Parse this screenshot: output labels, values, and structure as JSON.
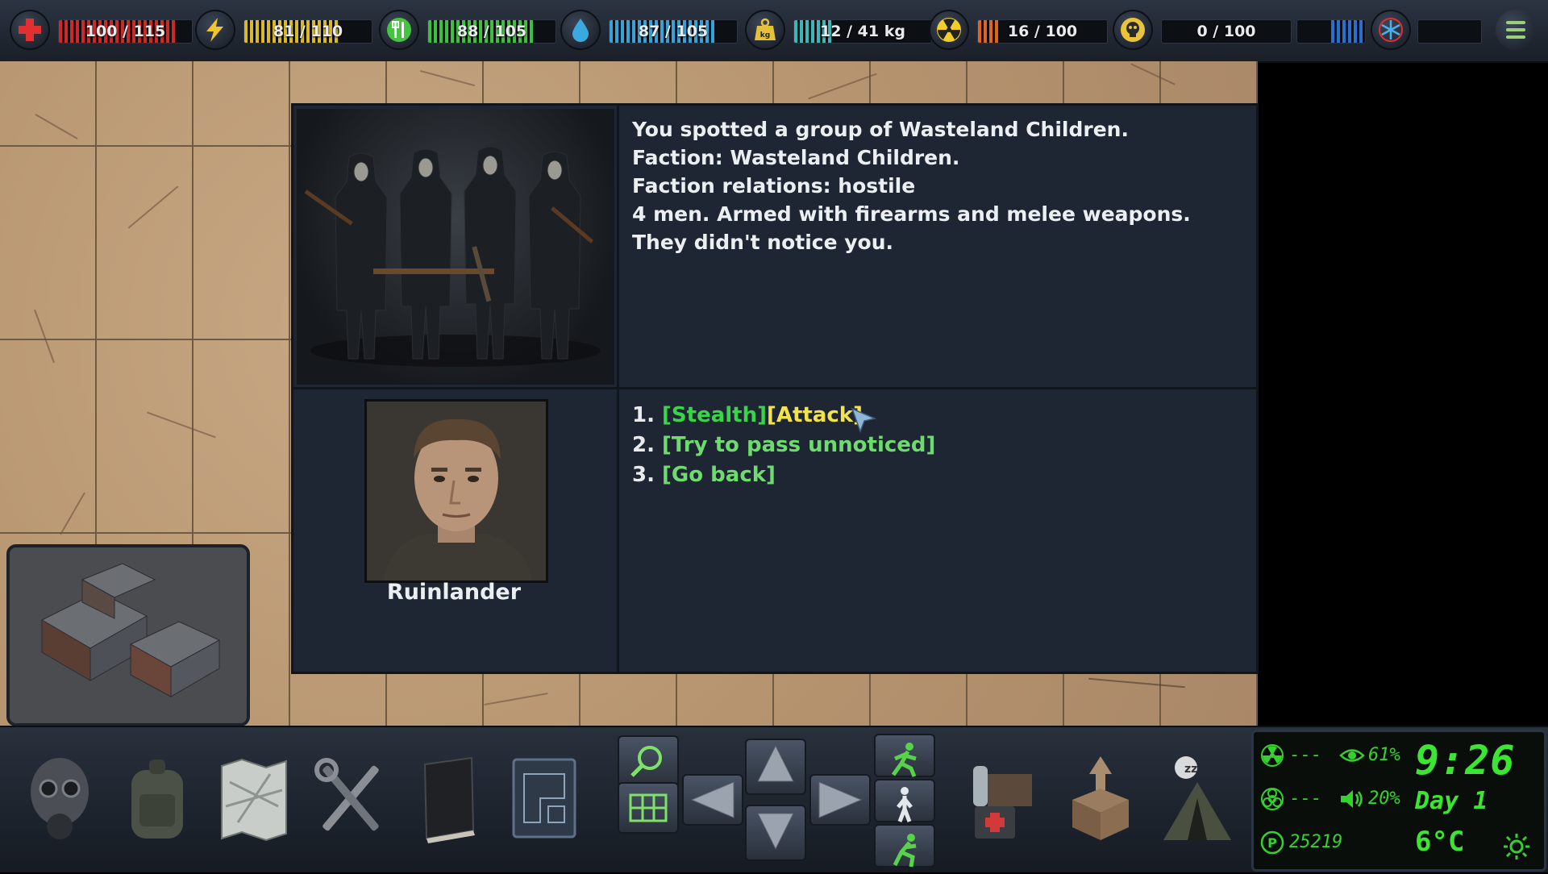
{
  "top_bar": {
    "stats": [
      {
        "name": "health",
        "text": "100 / 115",
        "fraction": 0.87,
        "color": "#d62a2a",
        "icon": "red-cross-icon"
      },
      {
        "name": "energy",
        "text": "81 / 110",
        "fraction": 0.74,
        "color": "#e4c12a",
        "icon": "lightning-icon"
      },
      {
        "name": "food",
        "text": "88 / 105",
        "fraction": 0.84,
        "color": "#3fc93f",
        "icon": "fork-knife-icon"
      },
      {
        "name": "water",
        "text": "87 / 105",
        "fraction": 0.83,
        "color": "#3aa9e0",
        "icon": "water-drop-icon"
      },
      {
        "name": "weight",
        "text": "12 / 41 kg",
        "fraction": 0.29,
        "color": "#3ec0c0",
        "icon": "weight-icon"
      },
      {
        "name": "radiation",
        "text": "16 / 100",
        "fraction": 0.16,
        "color": "#e86a1e",
        "icon": "radiation-icon"
      },
      {
        "name": "toxicity",
        "text": "0 / 100",
        "fraction": 0.0,
        "color": "#c9c9c9",
        "icon": "skull-icon"
      },
      {
        "name": "temperature",
        "text": "",
        "fraction": 0.5,
        "color": "#2e73d8",
        "icon": "snowflake-icon"
      }
    ],
    "menu_icon": "hamburger-menu-icon"
  },
  "encounter": {
    "description": [
      "You spotted a group of Wasteland Children.",
      "Faction: Wasteland Children.",
      "Faction relations: hostile",
      "4 men. Armed with firearms and melee weapons.",
      "They didn't notice you."
    ],
    "character_name": "Ruinlander",
    "options": [
      {
        "number": "1.",
        "stealth_tag": "[Stealth]",
        "attack_tag": "[Attack]"
      },
      {
        "number": "2.",
        "label": "[Try to pass unnoticed]"
      },
      {
        "number": "3.",
        "label": "[Go back]"
      }
    ]
  },
  "bottom_bar": {
    "tools": [
      "gas-mask-icon",
      "backpack-icon",
      "map-icon",
      "tools-icon",
      "journal-icon",
      "blueprint-icon"
    ],
    "nav": [
      "search-icon",
      "grid-icon",
      "arrow-up-icon",
      "arrow-left-icon",
      "arrow-right-icon",
      "arrow-down-icon",
      "run-icon",
      "walk-icon",
      "sneak-icon"
    ],
    "actions": [
      "supplies-icon",
      "storage-box-icon",
      "rest-tent-icon"
    ]
  },
  "status_panel": {
    "rad_one": "---",
    "rad_two": "---",
    "visibility": "61%",
    "noise": "20%",
    "points": "25219",
    "time": "9:26",
    "day": "Day 1",
    "temperature": "6°C"
  },
  "colors": {
    "accent_green": "#3be532",
    "stealth_green": "#39d447",
    "attack_yellow": "#f2e34b",
    "option_green": "#6edb6e",
    "panel_bg": "#1e2634"
  }
}
